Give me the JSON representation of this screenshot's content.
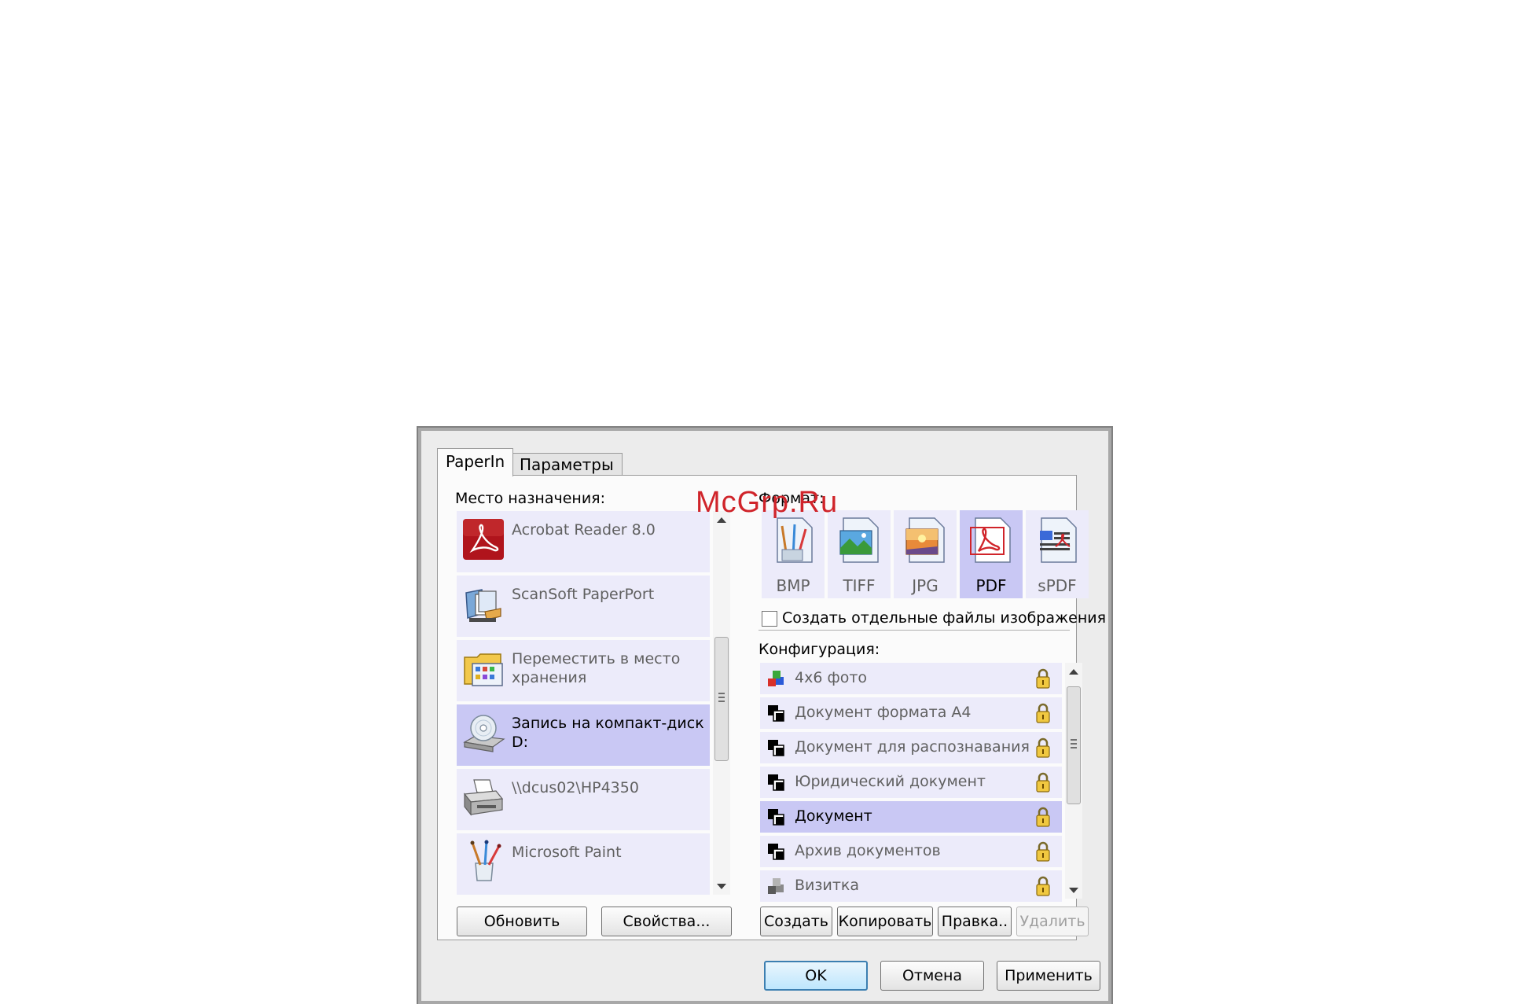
{
  "watermark": "McGrp.Ru",
  "tabs": [
    {
      "label": "PaperIn",
      "active": true
    },
    {
      "label": "Параметры",
      "active": false
    }
  ],
  "destination": {
    "label": "Место назначения:",
    "items": [
      {
        "name": "Acrobat Reader 8.0",
        "icon": "acrobat-icon",
        "selected": false
      },
      {
        "name": "ScanSoft PaperPort",
        "icon": "paperport-icon",
        "selected": false
      },
      {
        "name": "Переместить в место хранения",
        "icon": "storage-folder-icon",
        "selected": false
      },
      {
        "name": "Запись на компакт-диск D:",
        "icon": "cd-burner-icon",
        "selected": true
      },
      {
        "name": "\\\\dcus02\\HP4350",
        "icon": "printer-icon",
        "selected": false
      },
      {
        "name": "Microsoft Paint",
        "icon": "paint-brushes-icon",
        "selected": false
      }
    ]
  },
  "format": {
    "label": "Формат:",
    "items": [
      {
        "label": "BMP",
        "icon": "bmp-file-icon",
        "selected": false
      },
      {
        "label": "TIFF",
        "icon": "tiff-file-icon",
        "selected": false
      },
      {
        "label": "JPG",
        "icon": "jpg-file-icon",
        "selected": false
      },
      {
        "label": "PDF",
        "icon": "pdf-file-icon",
        "selected": true
      },
      {
        "label": "sPDF",
        "icon": "spdf-file-icon",
        "selected": false
      }
    ],
    "separate_files_label": "Создать отдельные файлы изображения",
    "separate_files_checked": false
  },
  "configuration": {
    "label": "Конфигурация:",
    "items": [
      {
        "name": "4x6 фото",
        "icon": "color-cubes-icon",
        "selected": false,
        "locked": true
      },
      {
        "name": "Документ формата A4",
        "icon": "bw-document-icon",
        "selected": false,
        "locked": true
      },
      {
        "name": "Документ для распознавания",
        "icon": "bw-document-icon",
        "selected": false,
        "locked": true
      },
      {
        "name": "Юридический документ",
        "icon": "bw-document-icon",
        "selected": false,
        "locked": true
      },
      {
        "name": "Документ",
        "icon": "bw-document-icon",
        "selected": true,
        "locked": true
      },
      {
        "name": "Архив документов",
        "icon": "bw-document-icon",
        "selected": false,
        "locked": true
      },
      {
        "name": "Визитка",
        "icon": "gray-cubes-icon",
        "selected": false,
        "locked": true
      }
    ]
  },
  "panel_buttons": {
    "refresh": "Обновить",
    "properties": "Свойства...",
    "create": "Создать",
    "copy": "Копировать",
    "edit": "Правка..",
    "delete": "Удалить"
  },
  "dialog_buttons": {
    "ok": "OK",
    "cancel": "Отмена",
    "apply": "Применить"
  },
  "colors": {
    "list_bg": "#ecebfa",
    "selected_bg": "#c9c8f4",
    "dialog_bg": "#ececec"
  }
}
